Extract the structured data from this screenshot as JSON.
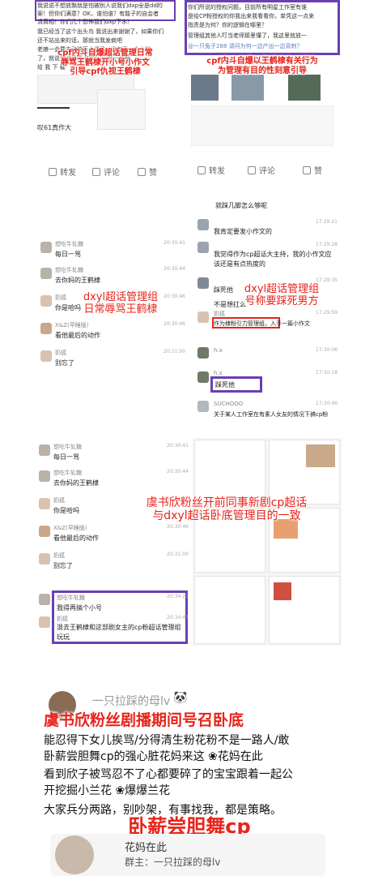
{
  "top_left": {
    "lines": [
      "我说说不想放飘就是怕被别人说我们dxp全是dd的",
      "案！但你们满意？OK，谁怕谁？有能子的自会者",
      "清真相！你们几个恐怖我们dxp下水！",
      "我已经当了这个出头鸟 我说出来谢谢了，如果你们",
      "还不站出来的话，那就当我发疯吧",
      "老娘一会要去动脑盲上课了，没有下一个小时",
      "了，就说到这里吧 你的问问世一说啊",
      "给 我 下 载"
    ],
    "overlay": "cpf内斗自爆超话管理日常\n辱骂王鹤棣开小号小作文\n引导cpf仇视王鹤棣",
    "bottom": "叹61真作大",
    "toolbar": {
      "repost": "转发",
      "comment": "评论",
      "like": "赞"
    }
  },
  "top_right": {
    "lines": [
      "你们所说的授权问题，目前所有明星工作室有谁",
      "是给CP粉授权的你我出来我看看你，单凭这一点来",
      "指责是为何？你的逻辑在哪里？",
      "管理组其他人叮当老师那里懂了，我这里就放一",
      "@一只兔子288 请问为何一边产出一边背刺？"
    ],
    "overlay": "cpf内斗自爆以王鹤棣有关行为\n为管理有目的性刻意引导",
    "toolbar": {
      "repost": "转发",
      "comment": "评论",
      "like": "赞"
    }
  },
  "mid_left": {
    "messages": [
      {
        "name": "想吃牛轧糖",
        "text": "每日一骂",
        "time": "20:30:41"
      },
      {
        "name": "想吃牛轧糖",
        "text": "去你妈的王鹤棣",
        "time": "20:30:44"
      },
      {
        "name": "奶狐",
        "text": "你是哈吗",
        "time": "20:30:46"
      },
      {
        "name": "X&Z(早睡版)",
        "text": "看他最后的动作",
        "time": "20:30:46"
      },
      {
        "name": "奶狐",
        "text": "别忘了",
        "time": "20:31:00"
      }
    ],
    "overlay": "dxyl超话管理组\n日常辱骂王鹤棣"
  },
  "mid_right": {
    "top_line": "就踩几脚怎么够呢",
    "messages": [
      {
        "name": "",
        "text": "我肯定要发小作文的",
        "time": "17:29:21"
      },
      {
        "name": "",
        "text": "我觉得作为cp超话大主持，我的小作文应该还是有点热度的",
        "time": "17:29:28"
      },
      {
        "name": "",
        "text": "踩死他",
        "time": "17:29:35"
      },
      {
        "name": "",
        "text": "不是想扛么",
        "time": ""
      },
      {
        "name": "奶狐",
        "text": "作为棣粉引力管理组，入手一篇小作文",
        "time": "17:29:59"
      },
      {
        "name": "h.x",
        "text": "",
        "time": "17:30:06"
      },
      {
        "name": "h.x",
        "text": "踩死他",
        "time": "17:30:18"
      },
      {
        "name": "SUCHOOO",
        "text": "关于某人工作室在有素人女友的情况下搞cp粉",
        "time": "17:30:46"
      }
    ],
    "overlay": "dxyl超话管理组\n号称要踩死男方"
  },
  "row3_left": {
    "messages": [
      {
        "name": "想吃牛轧糖",
        "text": "每日一骂",
        "time": "20:30:41"
      },
      {
        "name": "想吃牛轧糖",
        "text": "去你妈的王鹤棣",
        "time": "20:30:44"
      },
      {
        "name": "奶狐",
        "text": "你是哈吗",
        "time": "20:30:46"
      },
      {
        "name": "X&Z(早睡版)",
        "text": "看他最后的动作",
        "time": "20:30:46"
      },
      {
        "name": "奶狐",
        "text": "别忘了",
        "time": "20:31:00"
      }
    ],
    "boxed": [
      {
        "name": "想吃牛轧糖",
        "text": "我得再搞个小号",
        "time": "20:34:23"
      },
      {
        "name": "奶狐",
        "text": "混去王鹤棣和这部剧女主的cp粉超话管理组玩玩",
        "time": "20:34:47"
      }
    ]
  },
  "row3_overlay": "虞书欣粉丝开前同事新剧cp超话\n与dxyl超话卧底管理目的一致",
  "bottom": {
    "header_name": "一只拉踩的母lv",
    "overlay_title": "虞书欣粉丝剧播期间号召卧底",
    "lines": [
      "能忍得下女儿挨骂/分得清生粉花粉不是一路人/敢",
      "卧薪尝胆舞cp的强心脏花妈来这 ❀花妈在此",
      "看到欣子被骂忍不了心都要碎了的宝宝跟着一起公",
      "开挖掘小兰花 ❀爆爆兰花",
      "大家兵分两路，别吵架，有事找我，都是策略。"
    ],
    "overlay_bottom": "卧薪尝胆舞cp",
    "card_name": "花妈在此",
    "card_sub": "群主：一只拉踩的母lv"
  }
}
